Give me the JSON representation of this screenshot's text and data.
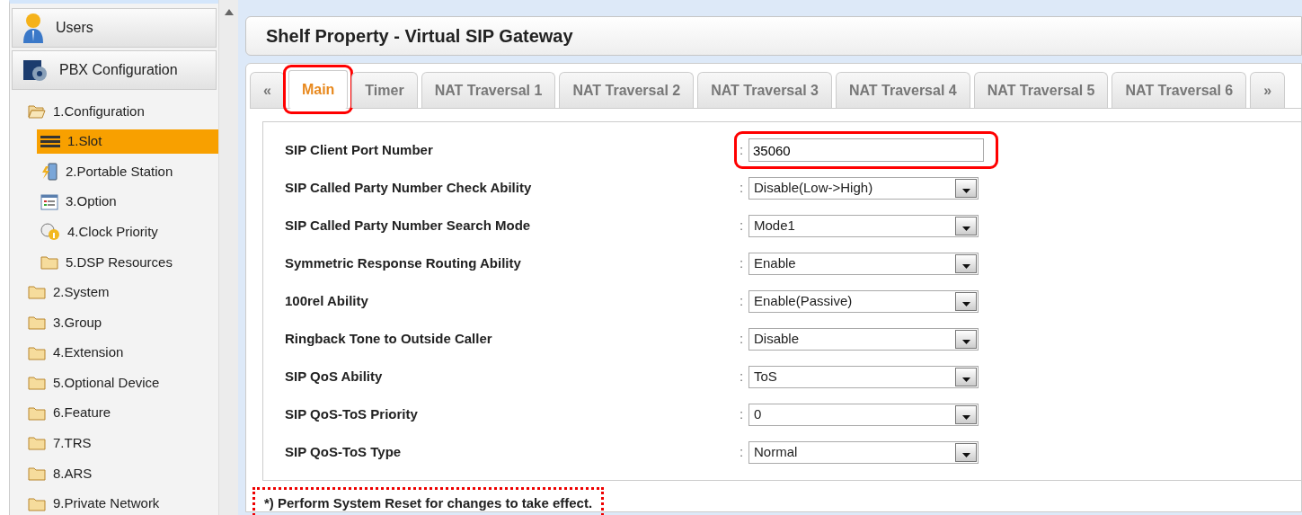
{
  "sidebar": {
    "sections": [
      {
        "label": "Users",
        "kind": "user"
      },
      {
        "label": "PBX Configuration",
        "kind": "pbx"
      }
    ],
    "tree": [
      {
        "label": "1.Configuration",
        "kind": "folder",
        "expanded": true,
        "selected": false,
        "children": [
          {
            "label": "1.Slot",
            "kind": "slot",
            "selected": true
          },
          {
            "label": "2.Portable Station",
            "kind": "portable",
            "selected": false
          },
          {
            "label": "3.Option",
            "kind": "option",
            "selected": false
          },
          {
            "label": "4.Clock Priority",
            "kind": "clock",
            "selected": false
          },
          {
            "label": "5.DSP Resources",
            "kind": "folder",
            "expanded": false,
            "selected": false
          }
        ]
      },
      {
        "label": "2.System",
        "kind": "folder",
        "expanded": false,
        "selected": false
      },
      {
        "label": "3.Group",
        "kind": "folder",
        "expanded": false,
        "selected": false
      },
      {
        "label": "4.Extension",
        "kind": "folder",
        "expanded": false,
        "selected": false
      },
      {
        "label": "5.Optional Device",
        "kind": "folder",
        "expanded": false,
        "selected": false
      },
      {
        "label": "6.Feature",
        "kind": "folder",
        "expanded": false,
        "selected": false
      },
      {
        "label": "7.TRS",
        "kind": "folder",
        "expanded": false,
        "selected": false
      },
      {
        "label": "8.ARS",
        "kind": "folder",
        "expanded": false,
        "selected": false
      },
      {
        "label": "9.Private Network",
        "kind": "folder",
        "expanded": false,
        "selected": false
      }
    ]
  },
  "page_title": "Shelf Property - Virtual SIP Gateway",
  "tab_prev": "«",
  "tab_next": "»",
  "tabs": [
    {
      "label": "Main",
      "selected": true,
      "highlighted": true
    },
    {
      "label": "Timer",
      "selected": false,
      "highlighted": false
    },
    {
      "label": "NAT Traversal 1",
      "selected": false,
      "highlighted": false
    },
    {
      "label": "NAT Traversal 2",
      "selected": false,
      "highlighted": false
    },
    {
      "label": "NAT Traversal 3",
      "selected": false,
      "highlighted": false
    },
    {
      "label": "NAT Traversal 4",
      "selected": false,
      "highlighted": false
    },
    {
      "label": "NAT Traversal 5",
      "selected": false,
      "highlighted": false
    },
    {
      "label": "NAT Traversal 6",
      "selected": false,
      "highlighted": false
    }
  ],
  "fields": [
    {
      "label": "SIP Client Port Number",
      "kind": "text",
      "value": "35060",
      "highlighted": true
    },
    {
      "label": "SIP Called Party Number Check Ability",
      "kind": "select",
      "value": "Disable(Low->High)",
      "highlighted": false
    },
    {
      "label": "SIP Called Party Number Search Mode",
      "kind": "select",
      "value": "Mode1",
      "highlighted": false
    },
    {
      "label": "Symmetric Response Routing Ability",
      "kind": "select",
      "value": "Enable",
      "highlighted": false
    },
    {
      "label": "100rel Ability",
      "kind": "select",
      "value": "Enable(Passive)",
      "highlighted": false
    },
    {
      "label": "Ringback Tone to Outside Caller",
      "kind": "select",
      "value": "Disable",
      "highlighted": false
    },
    {
      "label": "SIP QoS Ability",
      "kind": "select",
      "value": "ToS",
      "highlighted": false
    },
    {
      "label": "SIP QoS-ToS Priority",
      "kind": "select",
      "value": "0",
      "highlighted": false
    },
    {
      "label": "SIP QoS-ToS Type",
      "kind": "select",
      "value": "Normal",
      "highlighted": false
    }
  ],
  "separator": ":",
  "note": {
    "text": "*) Perform System Reset for changes to take effect.",
    "highlighted": true
  }
}
